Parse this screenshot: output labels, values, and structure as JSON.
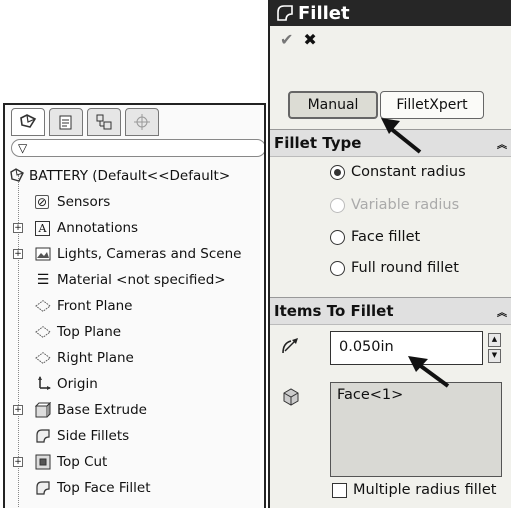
{
  "tree": {
    "tabs": [
      "feature-manager",
      "property-manager",
      "configuration-manager",
      "dim-xpert"
    ],
    "filter_glyph": "▽",
    "root_label": "BATTERY  (Default<<Default>",
    "items": [
      {
        "label": "Sensors",
        "icon": "sensor-icon",
        "expandable": false
      },
      {
        "label": "Annotations",
        "icon": "annotations-icon",
        "expandable": true
      },
      {
        "label": "Lights, Cameras and Scene",
        "icon": "lights-cameras-icon",
        "expandable": true
      },
      {
        "label": "Material <not specified>",
        "icon": "material-icon",
        "expandable": false
      },
      {
        "label": "Front Plane",
        "icon": "plane-icon",
        "expandable": false
      },
      {
        "label": "Top Plane",
        "icon": "plane-icon",
        "expandable": false
      },
      {
        "label": "Right Plane",
        "icon": "plane-icon",
        "expandable": false
      },
      {
        "label": "Origin",
        "icon": "origin-icon",
        "expandable": false
      },
      {
        "label": "Base Extrude",
        "icon": "extrude-icon",
        "expandable": true
      },
      {
        "label": "Side Fillets",
        "icon": "fillet-icon",
        "expandable": false
      },
      {
        "label": "Top Cut",
        "icon": "cut-icon",
        "expandable": true
      },
      {
        "label": "Top Face Fillet",
        "icon": "fillet-icon",
        "expandable": false
      }
    ]
  },
  "fillet": {
    "title": "Fillet",
    "ok_glyph": "✔",
    "cancel_glyph": "✖",
    "modes": [
      "Manual",
      "FilletXpert"
    ],
    "selected_mode": "Manual",
    "fillet_type": {
      "heading": "Fillet Type",
      "options": [
        {
          "label": "Constant radius",
          "selected": true,
          "disabled": false
        },
        {
          "label": "Variable radius",
          "selected": false,
          "disabled": true
        },
        {
          "label": "Face fillet",
          "selected": false,
          "disabled": false
        },
        {
          "label": "Full round fillet",
          "selected": false,
          "disabled": false
        }
      ]
    },
    "items": {
      "heading": "Items To Fillet",
      "radius_value": "0.050in",
      "selection": "Face<1>",
      "multiple_radius_label": "Multiple radius fillet",
      "multiple_radius_checked": false
    }
  },
  "colors": {
    "title_bar": "#262626",
    "panel_bg": "#f1f1ec",
    "group_head": "#e0e0e0",
    "arrow": "#111111"
  }
}
